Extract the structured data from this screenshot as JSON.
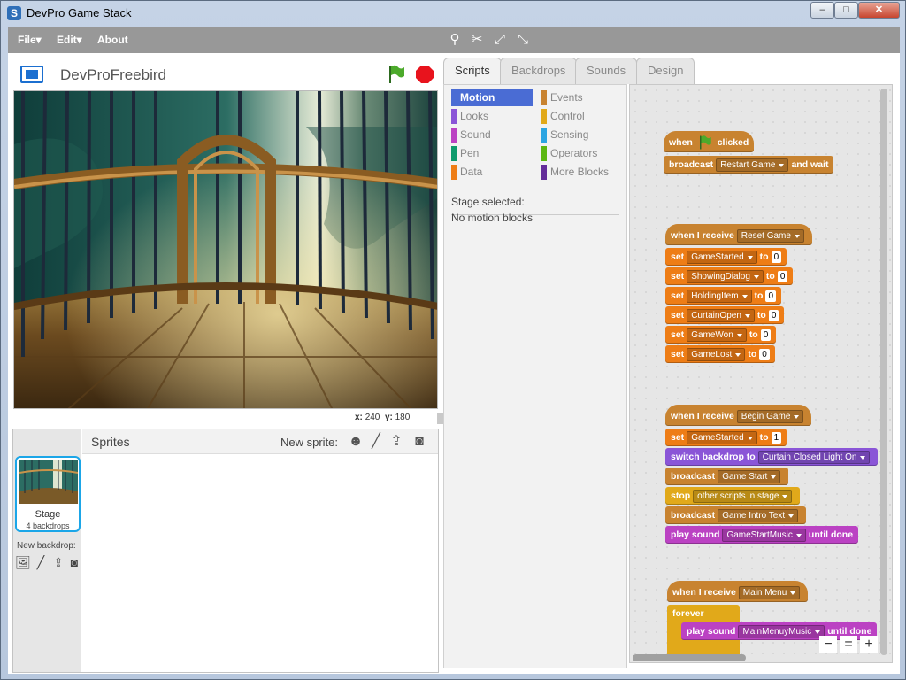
{
  "window": {
    "title": "DevPro Game Stack",
    "app_icon": "S",
    "minimize": "–",
    "maximize": "□",
    "close": "✕"
  },
  "menu": {
    "file": "File▾",
    "edit": "Edit▾",
    "about": "About"
  },
  "toolbar_icons": [
    "duplicate-stamp-icon",
    "cut-scissors-icon",
    "grow-icon",
    "shrink-icon"
  ],
  "stage": {
    "project_name": "DevProFreebird",
    "x_label": "x:",
    "x_value": "240",
    "y_label": "y:",
    "y_value": "180"
  },
  "sprites": {
    "title": "Sprites",
    "new_sprite_label": "New sprite:",
    "stage_label": "Stage",
    "stage_sub": "4 backdrops",
    "new_backdrop_label": "New backdrop:"
  },
  "tabs": [
    "Scripts",
    "Backdrops",
    "Sounds",
    "Design"
  ],
  "categories": [
    {
      "label": "Motion",
      "color": "#4a6cd4"
    },
    {
      "label": "Looks",
      "color": "#8a55d7"
    },
    {
      "label": "Sound",
      "color": "#bb42c3"
    },
    {
      "label": "Pen",
      "color": "#0e9a6c"
    },
    {
      "label": "Data",
      "color": "#ee7d16"
    },
    {
      "label": "Events",
      "color": "#c88330"
    },
    {
      "label": "Control",
      "color": "#e1a91a"
    },
    {
      "label": "Sensing",
      "color": "#2ca5e2"
    },
    {
      "label": "Operators",
      "color": "#5cb712"
    },
    {
      "label": "More Blocks",
      "color": "#632d99"
    }
  ],
  "palette": {
    "line1": "Stage selected:",
    "line2": "No motion blocks"
  },
  "blocks": {
    "b1_when": "when",
    "b1_clicked": "clicked",
    "b2_broadcast": "broadcast",
    "b2_msg": "Restart Game",
    "b2_wait": "and wait",
    "b3_when": "when I receive",
    "b3_msg": "Reset Game",
    "set": "set",
    "to": "to",
    "vars1": [
      {
        "name": "GameStarted",
        "val": "0"
      },
      {
        "name": "ShowingDialog",
        "val": "0"
      },
      {
        "name": "HoldingItem",
        "val": "0"
      },
      {
        "name": "CurtainOpen",
        "val": "0"
      },
      {
        "name": "GameWon",
        "val": "0"
      },
      {
        "name": "GameLost",
        "val": "0"
      }
    ],
    "b4_when": "when I receive",
    "b4_msg": "Begin Game",
    "b5_var": "GameStarted",
    "b5_val": "1",
    "b6_switch": "switch backdrop to",
    "b6_msg": "Curtain Closed Light On",
    "b7_broadcast": "broadcast",
    "b7_msg": "Game Start",
    "b8_stop": "stop",
    "b8_msg": "other scripts in stage",
    "b9_broadcast": "broadcast",
    "b9_msg": "Game Intro Text",
    "b10_play": "play sound",
    "b10_msg": "GameStartMusic",
    "b10_until": "until done",
    "b11_when": "when I receive",
    "b11_msg": "Main Menu",
    "b12_forever": "forever",
    "b13_play": "play sound",
    "b13_msg": "MainMenuyMusic",
    "b13_until": "until done"
  },
  "zoom": {
    "out": "−",
    "reset": "=",
    "in": "+"
  }
}
